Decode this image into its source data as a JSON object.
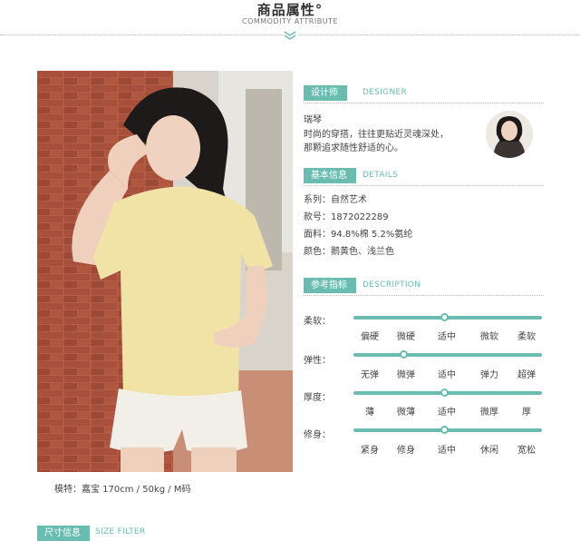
{
  "header": {
    "title": "商品属性°",
    "subtitle": "COMMODITY ATTRIBUTE"
  },
  "photo_caption": "模特：嘉宝   170cm / 50kg / M码",
  "designer": {
    "label": "设计师",
    "label_en": "DESIGNER",
    "name": "瑞琴",
    "line1": "时尚的穿搭，往往更贴近灵魂深处，",
    "line2": "那颗追求随性舒适的心。"
  },
  "details": {
    "label": "基本信息",
    "label_en": "DETAILS",
    "rows": [
      "系列：自然艺术",
      "款号：1872022289",
      "面料：94.8%棉 5.2%氨纶",
      "颜色：鹅黄色、浅兰色"
    ]
  },
  "description": {
    "label": "参考指标",
    "label_en": "DESCRIPTION",
    "indicators": [
      {
        "name": "柔软：",
        "options": [
          "偏硬",
          "微硬",
          "适中",
          "微软",
          "柔软"
        ],
        "selected_index": 2
      },
      {
        "name": "弹性：",
        "options": [
          "无弹",
          "微弹",
          "适中",
          "弹力",
          "超弹"
        ],
        "selected_index": 1
      },
      {
        "name": "厚度：",
        "options": [
          "薄",
          "微薄",
          "适中",
          "微厚",
          "厚"
        ],
        "selected_index": 2
      },
      {
        "name": "修身：",
        "options": [
          "紧身",
          "修身",
          "适中",
          "休闲",
          "宽松"
        ],
        "selected_index": 2
      }
    ]
  },
  "size": {
    "label": "尺寸信息",
    "label_en": "SIZE FILTER"
  },
  "colors": {
    "accent": "#6bbcb0",
    "shirt": "#f1e3a6",
    "shorts": "#f2efe8",
    "brick": "#a8553f"
  }
}
